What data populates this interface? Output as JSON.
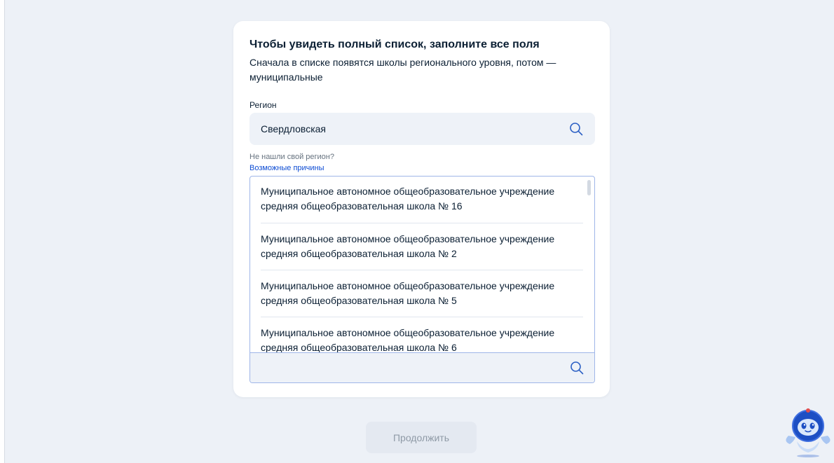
{
  "card": {
    "title": "Чтобы увидеть полный список, заполните все поля",
    "subtitle": "Сначала в списке появятся школы регионального уровня, потом — муниципальные"
  },
  "region": {
    "label": "Регион",
    "value": "Свердловская",
    "hint": "Не нашли свой регион?",
    "hint_link": "Возможные причины"
  },
  "school_dropdown": {
    "options": [
      "Муниципальное автономное общеобразовательное учреждение средняя общеобразовательная школа № 16",
      "Муниципальное автономное общеобразовательное учреждение средняя общеобразовательная школа № 2",
      "Муниципальное автономное общеобразовательное учреждение средняя общеобразовательная школа № 5",
      "Муниципальное автономное общеобразовательное учреждение средняя общеобразовательная школа № 6"
    ],
    "search_value": "",
    "search_placeholder": ""
  },
  "actions": {
    "continue_label": "Продолжить"
  },
  "colors": {
    "accent": "#0d4cd3",
    "icon": "#2b5fc4",
    "field_bg": "#eef2f8",
    "page_bg": "#edf1f7"
  },
  "icons": {
    "region_search": "search-icon",
    "dropdown_search": "search-icon",
    "assistant": "robot-assistant-icon"
  }
}
